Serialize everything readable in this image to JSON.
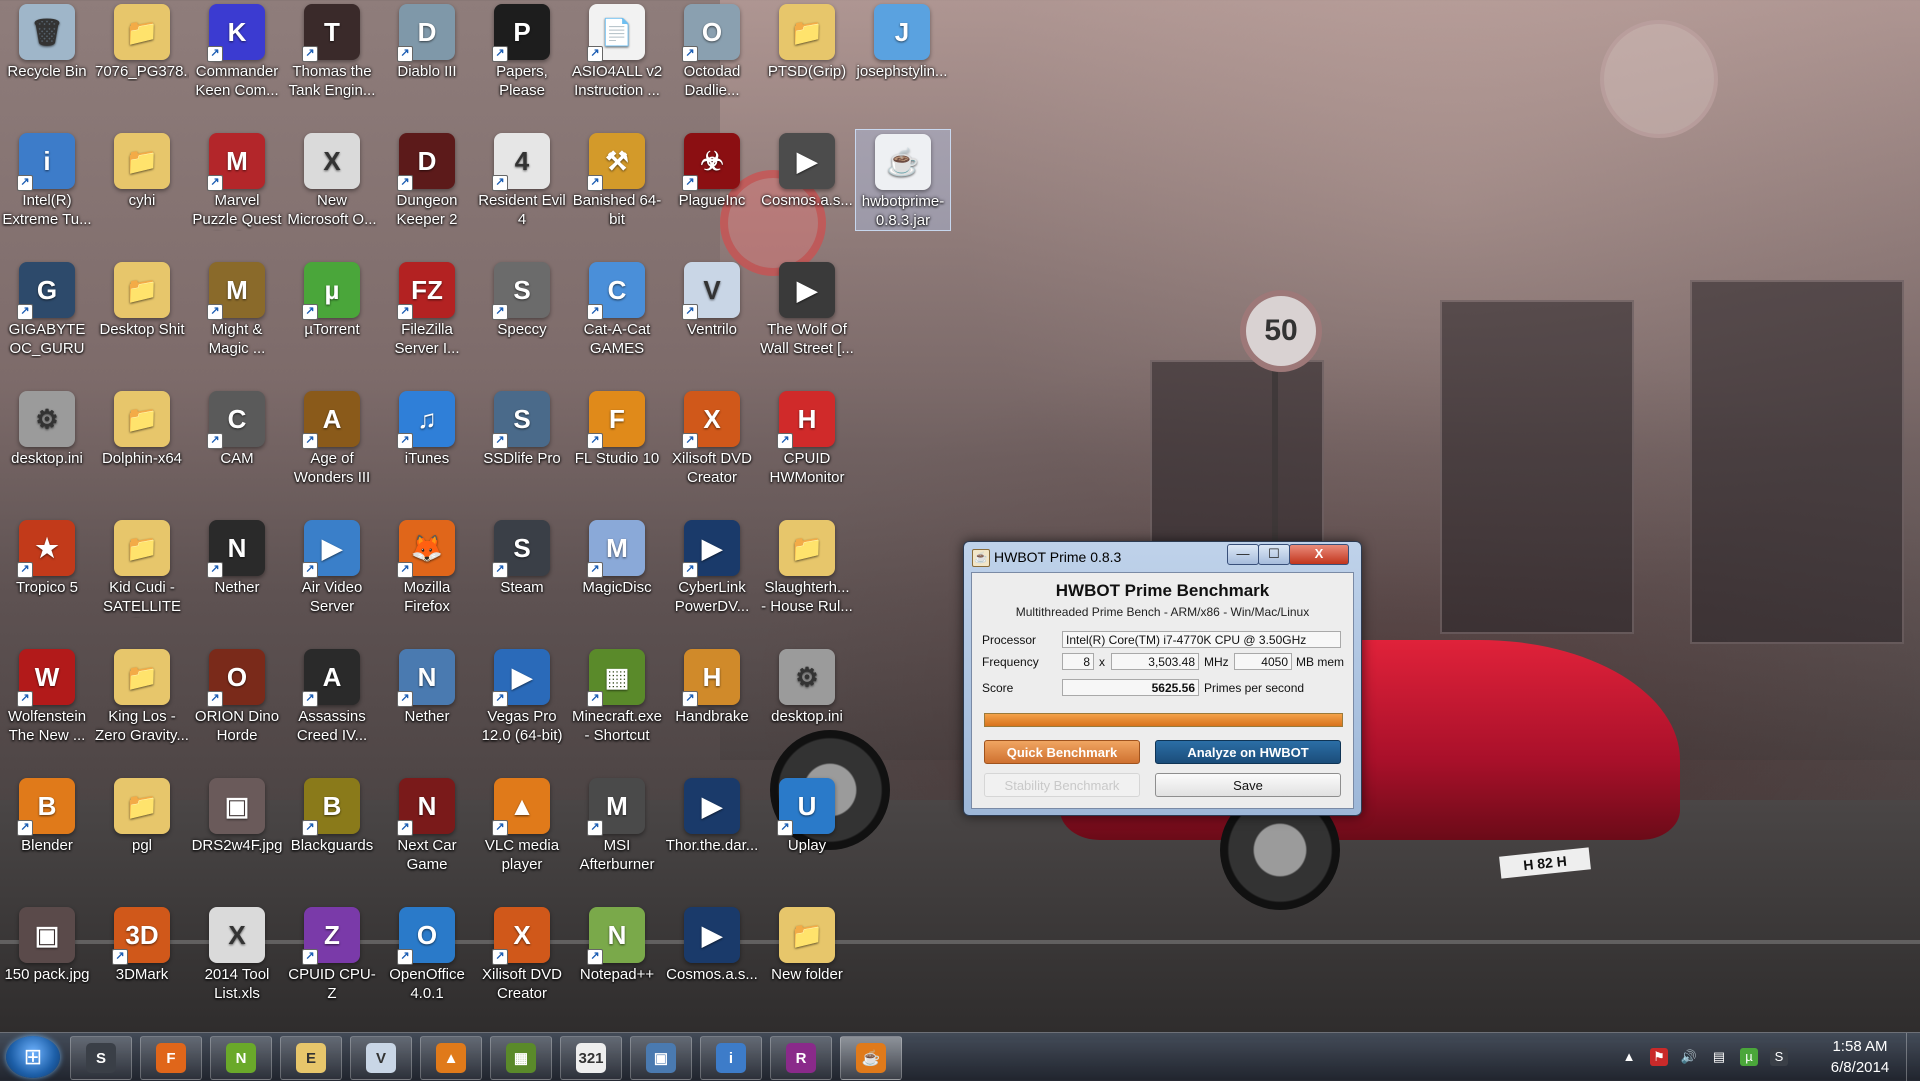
{
  "desktop": {
    "icons": [
      {
        "label": "Recycle Bin",
        "color": "#9fb6c9",
        "glyph": "🗑",
        "shortcut": false
      },
      {
        "label": "7076_PG378...",
        "color": "#e7c66b",
        "glyph": "📁",
        "shortcut": false
      },
      {
        "label": "Commander Keen Com...",
        "color": "#3b3bd1",
        "glyph": "K",
        "shortcut": true
      },
      {
        "label": "Thomas the Tank Engin...",
        "color": "#3a2a2a",
        "glyph": "T",
        "shortcut": true
      },
      {
        "label": "Diablo III",
        "color": "#7f98a9",
        "glyph": "D",
        "shortcut": true
      },
      {
        "label": "Papers, Please",
        "color": "#1d1d1d",
        "glyph": "P",
        "shortcut": true
      },
      {
        "label": "ASIO4ALL v2 Instruction ...",
        "color": "#f2f2f2",
        "glyph": "📄",
        "shortcut": true
      },
      {
        "label": "Octodad Dadlie...",
        "color": "#8aa0b0",
        "glyph": "O",
        "shortcut": true
      },
      {
        "label": "PTSD(Grip)",
        "color": "#e7c66b",
        "glyph": "📁",
        "shortcut": false
      },
      {
        "label": "josephstylin...",
        "color": "#5aa2e0",
        "glyph": "J",
        "shortcut": false
      },
      {
        "label": "Intel(R) Extreme Tu...",
        "color": "#3d7cc9",
        "glyph": "i",
        "shortcut": true
      },
      {
        "label": "cyhi",
        "color": "#e7c66b",
        "glyph": "📁",
        "shortcut": false
      },
      {
        "label": "Marvel Puzzle Quest Dark ...",
        "color": "#b3262a",
        "glyph": "M",
        "shortcut": true
      },
      {
        "label": "New Microsoft O...",
        "color": "#dadada",
        "glyph": "X",
        "shortcut": false
      },
      {
        "label": "Dungeon Keeper 2",
        "color": "#5c1a1a",
        "glyph": "D",
        "shortcut": true
      },
      {
        "label": "Resident Evil 4",
        "color": "#e6e6e6",
        "glyph": "4",
        "shortcut": true
      },
      {
        "label": "Banished 64-bit",
        "color": "#d39a2a",
        "glyph": "⚒",
        "shortcut": true
      },
      {
        "label": "PlagueInc",
        "color": "#8b0f12",
        "glyph": "☣",
        "shortcut": true
      },
      {
        "label": "Cosmos.a.s...",
        "color": "#4c4c4c",
        "glyph": "▶",
        "shortcut": false
      },
      {
        "label": "hwbotprime-0.8.3.jar",
        "color": "#eef0f3",
        "glyph": "☕",
        "shortcut": false,
        "selected": true
      },
      {
        "label": "GIGABYTE OC_GURU",
        "color": "#2d4a6b",
        "glyph": "G",
        "shortcut": true
      },
      {
        "label": "Desktop Shit",
        "color": "#e7c66b",
        "glyph": "📁",
        "shortcut": false
      },
      {
        "label": "Might & Magic ...",
        "color": "#8a6a2a",
        "glyph": "M",
        "shortcut": true
      },
      {
        "label": "µTorrent",
        "color": "#4aa63a",
        "glyph": "µ",
        "shortcut": true
      },
      {
        "label": "FileZilla Server I...",
        "color": "#b32222",
        "glyph": "FZ",
        "shortcut": true
      },
      {
        "label": "Speccy",
        "color": "#6b6b6b",
        "glyph": "S",
        "shortcut": true
      },
      {
        "label": "Cat-A-Cat GAMES",
        "color": "#4a8fd9",
        "glyph": "C",
        "shortcut": true
      },
      {
        "label": "Ventrilo",
        "color": "#c9d6e6",
        "glyph": "V",
        "shortcut": true
      },
      {
        "label": "The Wolf Of Wall Street [...",
        "color": "#3a3a3a",
        "glyph": "▶",
        "shortcut": false
      },
      {
        "label": "desktop.ini",
        "color": "#9b9b9b",
        "glyph": "⚙",
        "shortcut": false
      },
      {
        "label": "Dolphin-x64",
        "color": "#e7c66b",
        "glyph": "📁",
        "shortcut": false
      },
      {
        "label": "CAM",
        "color": "#5a5a5a",
        "glyph": "C",
        "shortcut": true
      },
      {
        "label": "Age of Wonders III",
        "color": "#8a5a1a",
        "glyph": "A",
        "shortcut": true
      },
      {
        "label": "iTunes",
        "color": "#2f7fd8",
        "glyph": "♫",
        "shortcut": true
      },
      {
        "label": "SSDlife Pro",
        "color": "#4a6a8a",
        "glyph": "S",
        "shortcut": true
      },
      {
        "label": "FL Studio 10",
        "color": "#e08a1a",
        "glyph": "F",
        "shortcut": true
      },
      {
        "label": "Xilisoft DVD Creator",
        "color": "#d0581a",
        "glyph": "X",
        "shortcut": true
      },
      {
        "label": "CPUID HWMonitor",
        "color": "#d02a2a",
        "glyph": "H",
        "shortcut": true
      },
      {
        "label": "Tropico 5",
        "color": "#c23a1a",
        "glyph": "★",
        "shortcut": true
      },
      {
        "label": "Kid Cudi - SATELLITE F...",
        "color": "#e7c66b",
        "glyph": "📁",
        "shortcut": false
      },
      {
        "label": "Nether",
        "color": "#2a2a2a",
        "glyph": "N",
        "shortcut": true
      },
      {
        "label": "Air Video Server",
        "color": "#3a7fc9",
        "glyph": "▶",
        "shortcut": true
      },
      {
        "label": "Mozilla Firefox",
        "color": "#e0661a",
        "glyph": "🦊",
        "shortcut": true
      },
      {
        "label": "Steam",
        "color": "#3a3f47",
        "glyph": "S",
        "shortcut": true
      },
      {
        "label": "MagicDisc",
        "color": "#8aa9d8",
        "glyph": "M",
        "shortcut": true
      },
      {
        "label": "CyberLink PowerDV...",
        "color": "#1a3a6a",
        "glyph": "▶",
        "shortcut": true
      },
      {
        "label": "Slaughterh... - House Rul...",
        "color": "#e7c66b",
        "glyph": "📁",
        "shortcut": false
      },
      {
        "label": "Wolfenstein The New ...",
        "color": "#b21a1a",
        "glyph": "W",
        "shortcut": true
      },
      {
        "label": "King Los - Zero Gravity...",
        "color": "#e7c66b",
        "glyph": "📁",
        "shortcut": false
      },
      {
        "label": "ORION Dino Horde",
        "color": "#7a2a1a",
        "glyph": "O",
        "shortcut": true
      },
      {
        "label": "Assassins Creed IV...",
        "color": "#2a2a2a",
        "glyph": "A",
        "shortcut": true
      },
      {
        "label": "Nether",
        "color": "#4a7ab0",
        "glyph": "N",
        "shortcut": true
      },
      {
        "label": "Vegas Pro 12.0 (64-bit)",
        "color": "#2a6ab9",
        "glyph": "▶",
        "shortcut": true
      },
      {
        "label": "Minecraft.exe - Shortcut",
        "color": "#5a8a2a",
        "glyph": "▦",
        "shortcut": true
      },
      {
        "label": "Handbrake",
        "color": "#d08a2a",
        "glyph": "H",
        "shortcut": true
      },
      {
        "label": "desktop.ini",
        "color": "#9b9b9b",
        "glyph": "⚙",
        "shortcut": false
      },
      {
        "label": "Blender",
        "color": "#e07a1a",
        "glyph": "B",
        "shortcut": true
      },
      {
        "label": "pgl",
        "color": "#e7c66b",
        "glyph": "📁",
        "shortcut": false
      },
      {
        "label": "DRS2w4F.jpg",
        "color": "#6a5a5a",
        "glyph": "▣",
        "shortcut": false
      },
      {
        "label": "Blackguards",
        "color": "#8a7a1a",
        "glyph": "B",
        "shortcut": true
      },
      {
        "label": "Next Car Game",
        "color": "#7a1a1a",
        "glyph": "N",
        "shortcut": true
      },
      {
        "label": "VLC media player",
        "color": "#e07a1a",
        "glyph": "▲",
        "shortcut": true
      },
      {
        "label": "MSI Afterburner",
        "color": "#4a4a4a",
        "glyph": "M",
        "shortcut": true
      },
      {
        "label": "Thor.the.dar...",
        "color": "#1a3a6a",
        "glyph": "▶",
        "shortcut": false
      },
      {
        "label": "Uplay",
        "color": "#2a7ac9",
        "glyph": "U",
        "shortcut": true
      },
      {
        "label": "150 pack.jpg",
        "color": "#5a4a4a",
        "glyph": "▣",
        "shortcut": false
      },
      {
        "label": "3DMark",
        "color": "#d0581a",
        "glyph": "3D",
        "shortcut": true
      },
      {
        "label": "2014 Tool List.xls",
        "color": "#dadada",
        "glyph": "X",
        "shortcut": false
      },
      {
        "label": "CPUID CPU-Z",
        "color": "#7a3aa9",
        "glyph": "Z",
        "shortcut": true
      },
      {
        "label": "OpenOffice 4.0.1",
        "color": "#2a7ac9",
        "glyph": "O",
        "shortcut": true
      },
      {
        "label": "Xilisoft DVD Creator",
        "color": "#d0581a",
        "glyph": "X",
        "shortcut": true
      },
      {
        "label": "Notepad++",
        "color": "#7aa94a",
        "glyph": "N",
        "shortcut": true
      },
      {
        "label": "Cosmos.a.s...",
        "color": "#1a3a6a",
        "glyph": "▶",
        "shortcut": false
      },
      {
        "label": "New folder",
        "color": "#e7c66b",
        "glyph": "📁",
        "shortcut": false
      }
    ]
  },
  "window": {
    "title": "HWBOT Prime 0.8.3",
    "icon": "java-icon",
    "minimize": "—",
    "maximize": "☐",
    "close": "X",
    "heading": "HWBOT Prime Benchmark",
    "subtitle": "Multithreaded Prime Bench - ARM/x86 - Win/Mac/Linux",
    "processor_label": "Processor",
    "processor_value": "Intel(R) Core(TM) i7-4770K CPU @ 3.50GHz",
    "frequency_label": "Frequency",
    "multiplier": "8",
    "x_sign": "x",
    "frequency_value": "3,503.48",
    "mhz": "MHz",
    "memory_value": "4050",
    "mb_mem": "MB mem",
    "score_label": "Score",
    "score_value": "5625.56",
    "score_unit": "Primes per second",
    "progress": 1.0,
    "btn_quick": "Quick Benchmark",
    "btn_analyze": "Analyze on HWBOT",
    "btn_stability": "Stability Benchmark",
    "btn_save": "Save"
  },
  "taskbar": {
    "start_glyph": "⊞",
    "items": [
      {
        "name": "steam",
        "glyph": "S",
        "color": "#3a3f47"
      },
      {
        "name": "firefox",
        "glyph": "F",
        "color": "#e0661a"
      },
      {
        "name": "nvidia",
        "glyph": "N",
        "color": "#6aa92a"
      },
      {
        "name": "explorer",
        "glyph": "E",
        "color": "#e7c66b"
      },
      {
        "name": "ventrilo",
        "glyph": "V",
        "color": "#c9d6e6"
      },
      {
        "name": "vlc",
        "glyph": "▲",
        "color": "#e07a1a"
      },
      {
        "name": "minecraft",
        "glyph": "▦",
        "color": "#5a8a2a"
      },
      {
        "name": "321",
        "glyph": "321",
        "color": "#eeeeee"
      },
      {
        "name": "monitor",
        "glyph": "▣",
        "color": "#4a7ab0"
      },
      {
        "name": "intel",
        "glyph": "i",
        "color": "#3d7cc9"
      },
      {
        "name": "winrar",
        "glyph": "R",
        "color": "#8a2a8a"
      },
      {
        "name": "java",
        "glyph": "☕",
        "color": "#e07a1a",
        "active": true
      }
    ],
    "tray": [
      {
        "name": "tray-up-arrow-icon",
        "glyph": "▲",
        "color": "transparent"
      },
      {
        "name": "tray-flag-icon",
        "glyph": "⚑",
        "color": "#c92a2a"
      },
      {
        "name": "tray-speaker-icon",
        "glyph": "🔊",
        "color": "transparent"
      },
      {
        "name": "tray-network-icon",
        "glyph": "▤",
        "color": "transparent"
      },
      {
        "name": "tray-utorrent-icon",
        "glyph": "µ",
        "color": "#4aa63a"
      },
      {
        "name": "tray-steam-icon",
        "glyph": "S",
        "color": "#3a3f47"
      }
    ],
    "time": "1:58 AM",
    "date": "6/8/2014"
  }
}
